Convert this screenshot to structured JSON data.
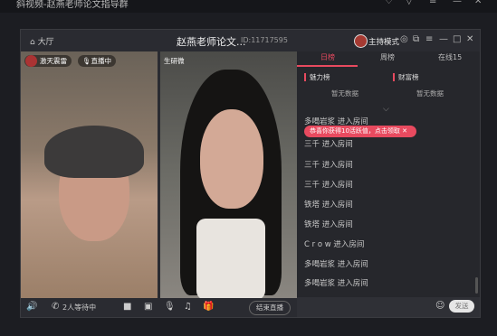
{
  "outer": {
    "title": "斜视频-赵燕老师论文指导群"
  },
  "window": {
    "home": "大厅",
    "title": "赵燕老师论文...",
    "id": "ID:11717595",
    "host_mode": "主持模式"
  },
  "video": {
    "user1_name": "激天震雷",
    "user1_status": "直播中",
    "user2_name": "生研微"
  },
  "bottom": {
    "waiting": "2人等待中",
    "end_live": "结束直播"
  },
  "panel": {
    "tabs": [
      "日榜",
      "周榜",
      "在线15"
    ],
    "charm_label": "魅力榜",
    "wealth_label": "财富榜",
    "no_data": "暂无数据",
    "toast": "恭喜你获得10活跃值，点击领取",
    "messages": [
      "多喝岩浆 进入房间",
      "三千 进入房间",
      "三千 进入房间",
      "三千 进入房间",
      "铁塔 进入房间",
      "铁塔 进入房间",
      "C r o w 进入房间",
      "多喝岩浆 进入房间",
      "多喝岩浆 进入房间"
    ],
    "send_label": "发送"
  }
}
